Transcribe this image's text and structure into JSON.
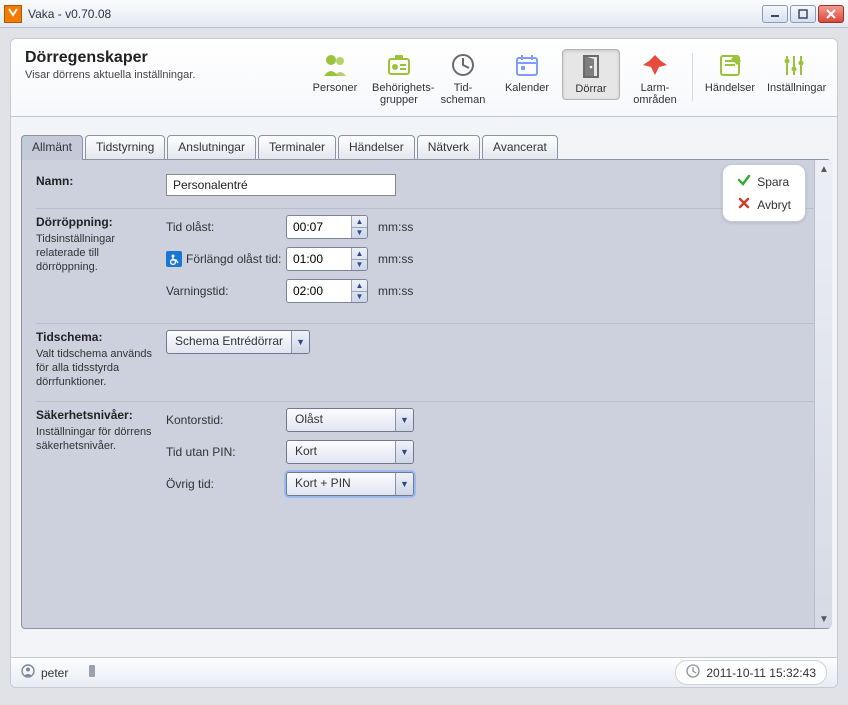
{
  "window": {
    "title": "Vaka - v0.70.08"
  },
  "heading": {
    "title": "Dörregenskaper",
    "subtitle": "Visar dörrens aktuella inställningar."
  },
  "toolbar": [
    {
      "id": "personer",
      "label": "Personer",
      "icon": "people",
      "color": "#9ac33a"
    },
    {
      "id": "behorighet",
      "label": "Behörighets-\ngrupper",
      "icon": "badge",
      "color": "#9ac33a"
    },
    {
      "id": "tidscheman",
      "label": "Tid-\nscheman",
      "icon": "clock",
      "color": "#6b6b6b"
    },
    {
      "id": "kalender",
      "label": "Kalender",
      "icon": "calendar",
      "color": "#7e9bff"
    },
    {
      "id": "dorrar",
      "label": "Dörrar",
      "icon": "door",
      "color": "#6b6b6b",
      "active": true
    },
    {
      "id": "larm",
      "label": "Larm-\nområden",
      "icon": "alarm",
      "color": "#e64b3c"
    },
    {
      "sep": true
    },
    {
      "id": "handelser",
      "label": "Händelser",
      "icon": "notes",
      "color": "#9ac33a"
    },
    {
      "id": "installningar",
      "label": "Inställningar",
      "icon": "sliders",
      "color": "#9ac33a"
    }
  ],
  "tabs": [
    {
      "id": "allmant",
      "label": "Allmänt",
      "active": true
    },
    {
      "id": "tidstyrning",
      "label": "Tidstyrning"
    },
    {
      "id": "anslutningar",
      "label": "Anslutningar"
    },
    {
      "id": "terminaler",
      "label": "Terminaler"
    },
    {
      "id": "handelser2",
      "label": "Händelser"
    },
    {
      "id": "natverk",
      "label": "Nätverk"
    },
    {
      "id": "avancerat",
      "label": "Avancerat"
    }
  ],
  "actions": {
    "save": "Spara",
    "cancel": "Avbryt"
  },
  "form": {
    "name_label": "Namn:",
    "name_value": "Personalentré",
    "opening": {
      "section_label": "Dörröppning:",
      "section_desc": "Tidsinställningar relaterade till dörröppning.",
      "rows": {
        "tid_olast": {
          "label": "Tid olåst:",
          "value": "00:07",
          "unit": "mm:ss"
        },
        "forlangd": {
          "label": "Förlängd olåst tid:",
          "value": "01:00",
          "unit": "mm:ss",
          "wheelchair": true
        },
        "varning": {
          "label": "Varningstid:",
          "value": "02:00",
          "unit": "mm:ss"
        }
      }
    },
    "tidschema": {
      "section_label": "Tidschema:",
      "section_desc": "Valt tidschema används för alla tidsstyrda dörrfunktioner.",
      "value": "Schema Entrédörrar"
    },
    "sakerhet": {
      "section_label": "Säkerhetsnivåer:",
      "section_desc": "Inställningar för dörrens säkerhetsnivåer.",
      "rows": {
        "kontorstid": {
          "label": "Kontorstid:",
          "value": "Olåst"
        },
        "tid_utan_pin": {
          "label": "Tid utan PIN:",
          "value": "Kort"
        },
        "ovrig_tid": {
          "label": "Övrig tid:",
          "value": "Kort + PIN",
          "highlight": true
        }
      }
    }
  },
  "status": {
    "user": "peter",
    "datetime": "2011-10-11 15:32:43"
  }
}
